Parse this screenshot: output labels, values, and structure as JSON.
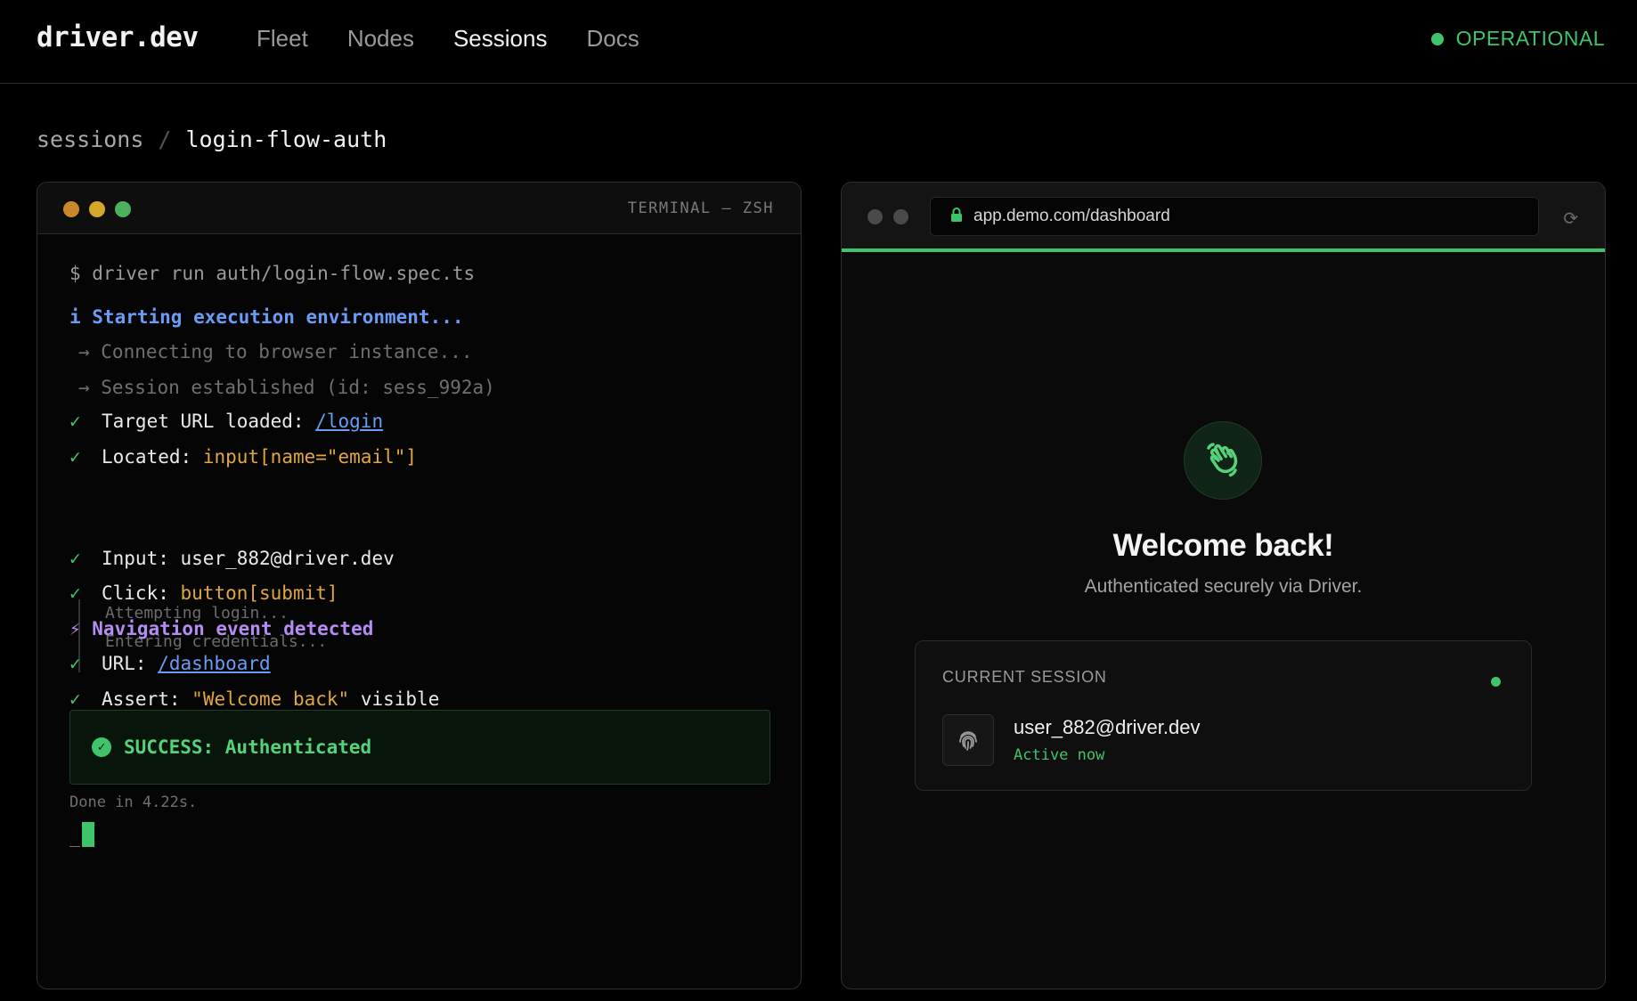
{
  "header": {
    "logo": "driver.dev",
    "nav": [
      {
        "label": "Fleet",
        "active": false
      },
      {
        "label": "Nodes",
        "active": false
      },
      {
        "label": "Sessions",
        "active": true
      },
      {
        "label": "Docs",
        "active": false
      }
    ],
    "status": "OPERATIONAL",
    "status_color": "#3fc46b"
  },
  "breadcrumb": {
    "parent": "sessions",
    "separator": "/",
    "current": "login-flow-auth"
  },
  "terminal": {
    "title": "TERMINAL — ZSH",
    "traffic_colors": [
      "#c9892b",
      "#d4a72c",
      "#4bb15f"
    ],
    "command": "$ driver run auth/login-flow.spec.ts",
    "info": "i Starting execution environment...",
    "step_connecting": "→ Connecting to browser instance...",
    "step_session": "→ Session established (id: sess_992a)",
    "check_mark": "✓",
    "target_label": "Target URL loaded:",
    "target_link": "/login",
    "located_label": "Located:",
    "located_value": "input[name=\"email\"]",
    "sub_attempting": "Attempting login...",
    "sub_credentials": "Entering credentials...",
    "input_label": "Input:",
    "input_value": "user_882@driver.dev",
    "click_label": "Click:",
    "click_value": "button[submit]",
    "nav_event": "⚡ Navigation event detected",
    "url_label": "URL:",
    "url_link": "/dashboard",
    "assert_label": "Assert:",
    "assert_value": "\"Welcome back\"",
    "assert_suffix": "visible",
    "success": "SUCCESS: Authenticated",
    "done": "Done in 4.22s.",
    "prompt_underscore": "_"
  },
  "browser": {
    "url": "app.demo.com/dashboard",
    "welcome_title": "Welcome back!",
    "welcome_subtitle": "Authenticated securely via Driver.",
    "session_card": {
      "label": "CURRENT SESSION",
      "email": "user_882@driver.dev",
      "status": "Active now"
    },
    "icons": {
      "lock": "lock-icon",
      "reload": "reload-icon",
      "wave": "waving-hand-icon",
      "fingerprint": "fingerprint-icon"
    }
  }
}
